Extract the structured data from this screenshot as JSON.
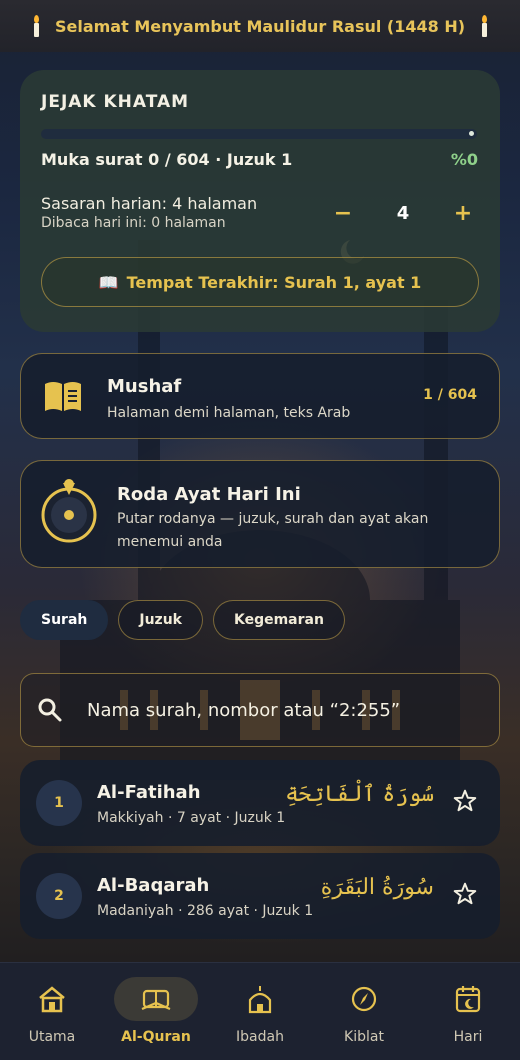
{
  "banner": {
    "text": "Selamat Menyambut Maulidur Rasul (1448 H)"
  },
  "khatam": {
    "title": "JEJAK KHATAM",
    "progress_fraction": 0,
    "muka_surat": "Muka surat 0 / 604 · Juzuk 1",
    "percent": "%0",
    "sasaran": "Sasaran harian: 4 halaman",
    "dibaca": "Dibaca hari ini: 0 halaman",
    "stepper": {
      "minus": "−",
      "value": "4",
      "plus": "+"
    },
    "last_place": {
      "icon": "📖",
      "label": "Tempat Terakhir: Surah 1, ayat 1"
    }
  },
  "mushaf": {
    "title": "Mushaf",
    "subtitle": "Halaman demi halaman, teks Arab",
    "pages": "1 / 604"
  },
  "roda": {
    "title": "Roda Ayat Hari Ini",
    "subtitle": "Putar rodanya — juzuk, surah dan ayat akan menemui anda"
  },
  "tabs": [
    {
      "label": "Surah",
      "active": true
    },
    {
      "label": "Juzuk",
      "active": false
    },
    {
      "label": "Kegemaran",
      "active": false
    }
  ],
  "search": {
    "placeholder": "Nama surah, nombor atau “2:255”"
  },
  "surahs": [
    {
      "number": "1",
      "name": "Al-Fatihah",
      "meta": "Makkiyah · 7 ayat · Juzuk 1",
      "arabic": "سُورَةُ ٱلْفَاتِحَةِ"
    },
    {
      "number": "2",
      "name": "Al-Baqarah",
      "meta": "Madaniyah · 286 ayat · Juzuk 1",
      "arabic": "سُورَةُ البَقَرَةِ"
    }
  ],
  "nav": [
    {
      "label": "Utama",
      "icon": "home-icon",
      "active": false
    },
    {
      "label": "Al-Quran",
      "icon": "quran-icon",
      "active": true
    },
    {
      "label": "Ibadah",
      "icon": "mosque-icon",
      "active": false
    },
    {
      "label": "Kiblat",
      "icon": "compass-icon",
      "active": false
    },
    {
      "label": "Hari",
      "icon": "calendar-icon",
      "active": false
    }
  ],
  "colors": {
    "gold": "#e6c24f",
    "green_percent": "#8fd08a",
    "card": "#161e2c"
  }
}
